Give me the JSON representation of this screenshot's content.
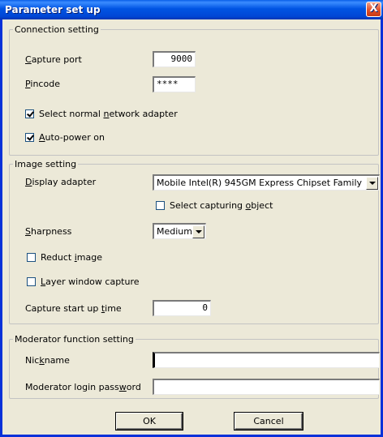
{
  "window": {
    "title": "Parameter set up",
    "close_glyph": "X"
  },
  "connection": {
    "legend": "Connection setting",
    "capture_port": {
      "pre": "",
      "key": "C",
      "post": "apture port",
      "value": "9000"
    },
    "pincode": {
      "pre": "",
      "key": "P",
      "post": "incode",
      "value": "****"
    },
    "normal_network": {
      "pre": "Select normal ",
      "key": "n",
      "post": "etwork adapter",
      "checked": true
    },
    "auto_power": {
      "pre": "",
      "key": "A",
      "post": "uto-power on",
      "checked": true
    }
  },
  "image": {
    "legend": "Image setting",
    "display_adapter": {
      "pre": "",
      "key": "D",
      "post": "isplay adapter",
      "value": "Mobile Intel(R) 945GM Express Chipset Family"
    },
    "capturing_object": {
      "pre": "Select capturing ",
      "key": "o",
      "post": "bject",
      "checked": false
    },
    "sharpness": {
      "pre": "",
      "key": "S",
      "post": "harpness",
      "value": "Medium"
    },
    "reduct_image": {
      "pre": "Reduct ",
      "key": "i",
      "post": "mage",
      "checked": false
    },
    "layer_window": {
      "pre": "",
      "key": "L",
      "post": "ayer window capture",
      "checked": false
    },
    "startup_time": {
      "pre": "Capture start up ",
      "key": "t",
      "post": "ime",
      "value": "0"
    }
  },
  "moderator": {
    "legend": "Moderator function setting",
    "nickname": {
      "pre": "Nic",
      "key": "k",
      "post": "name",
      "value": ""
    },
    "password": {
      "pre": "Moderator login pass",
      "key": "w",
      "post": "ord",
      "value": ""
    }
  },
  "buttons": {
    "ok": "OK",
    "cancel": "Cancel"
  }
}
